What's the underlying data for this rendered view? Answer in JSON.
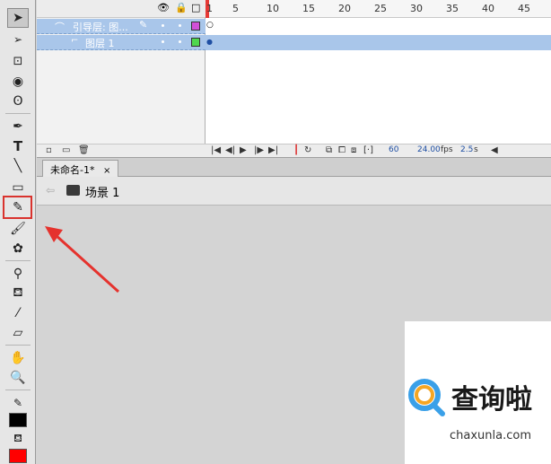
{
  "toolbar": {
    "tools": [
      "selection-tool",
      "subselection-tool",
      "free-transform-tool",
      "3d-rotation-tool",
      "lasso-tool",
      "pen-tool",
      "text-tool",
      "line-tool",
      "rectangle-tool",
      "pencil-tool",
      "brush-tool",
      "deco-tool",
      "bone-tool",
      "paint-bucket-tool",
      "eyedropper-tool",
      "eraser-tool",
      "hand-tool",
      "zoom-tool",
      "stroke-color",
      "fill-color"
    ],
    "text_tool_glyph": "T",
    "stroke_color": "#000000",
    "fill_color": "#ff0000",
    "highlight_color": "#d9332e"
  },
  "timeline": {
    "layers": [
      {
        "name": "引导层: 图..."
      },
      {
        "name": "图层 1"
      }
    ],
    "ruler_ticks": [
      "1",
      "5",
      "10",
      "15",
      "20",
      "25",
      "30",
      "35",
      "40",
      "45"
    ],
    "status": {
      "current_frame": "60",
      "fps_value": "24.00",
      "fps_unit": "fps",
      "elapsed_value": "2.5",
      "elapsed_unit": "s"
    },
    "layer_highlight_color": "#a9c6ea"
  },
  "document": {
    "tab_label": "未命名-1*",
    "tab_close": "×",
    "scene_label": "场景 1"
  },
  "watermark": {
    "brand": "查询啦",
    "url": "chaxunla.com"
  }
}
